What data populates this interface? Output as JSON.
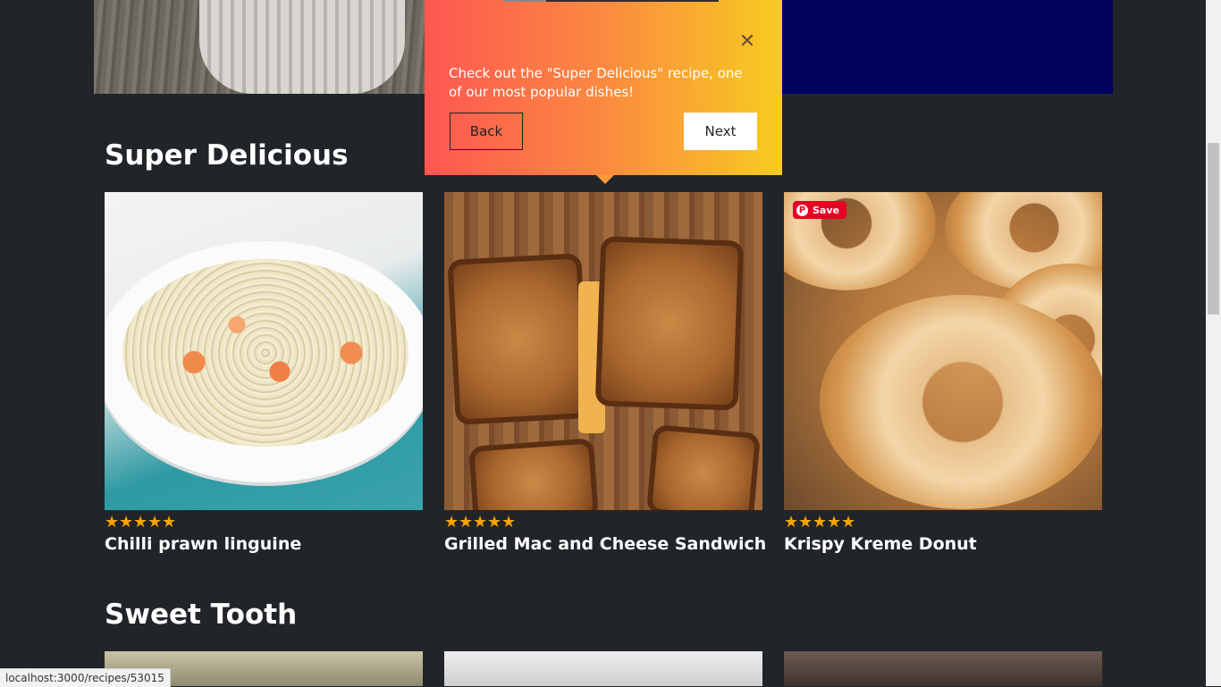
{
  "sections": [
    {
      "title": "Super Delicious",
      "cards": [
        {
          "title": "Chilli prawn linguine",
          "rating": 5
        },
        {
          "title": "Grilled Mac and Cheese Sandwich",
          "rating": 5
        },
        {
          "title": "Krispy Kreme Donut",
          "rating": 5,
          "save_label": "Save"
        }
      ]
    },
    {
      "title": "Sweet Tooth",
      "cards": []
    }
  ],
  "tour": {
    "message": "Check out the \"Super Delicious\" recipe, one of our most popular dishes!",
    "back_label": "Back",
    "next_label": "Next",
    "close_icon": "close-icon",
    "progress": 0.2
  },
  "status_bar": {
    "url": "localhost:3000/recipes/53015"
  },
  "colors": {
    "page_background": "#212529",
    "star": "#f7a400",
    "tour_gradient_start": "#fe5752",
    "tour_gradient_end": "#f7cc21",
    "pinterest": "#e60023"
  }
}
